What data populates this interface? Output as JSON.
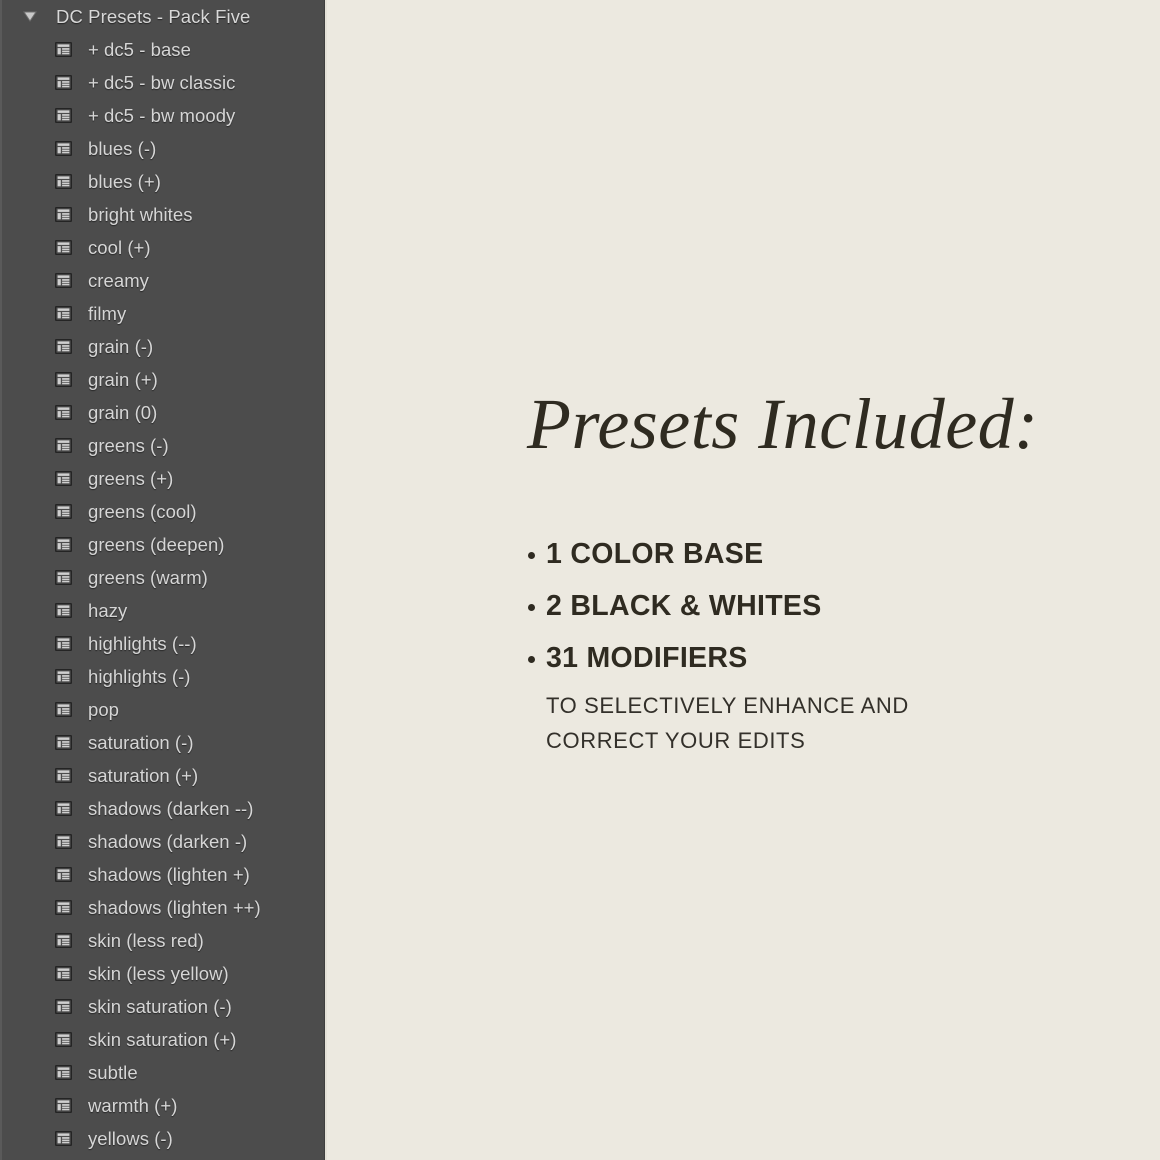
{
  "colors": {
    "sidebar_bg": "#4c4c4c",
    "sidebar_text": "#d6d6d6",
    "panel_bg": "#ece9e0",
    "panel_text": "#2f2b21"
  },
  "sidebar": {
    "group": {
      "title": "DC Presets - Pack Five",
      "disclosure_icon": "triangle-down-icon",
      "expanded": true
    },
    "item_icon": "preset-table-icon",
    "items": [
      {
        "label": "+ dc5 - base"
      },
      {
        "label": "+ dc5 - bw classic"
      },
      {
        "label": "+ dc5 - bw moody"
      },
      {
        "label": "blues (-)"
      },
      {
        "label": "blues (+)"
      },
      {
        "label": "bright whites"
      },
      {
        "label": "cool (+)"
      },
      {
        "label": "creamy"
      },
      {
        "label": "filmy"
      },
      {
        "label": "grain (-)"
      },
      {
        "label": "grain (+)"
      },
      {
        "label": "grain (0)"
      },
      {
        "label": "greens (-)"
      },
      {
        "label": "greens (+)"
      },
      {
        "label": "greens (cool)"
      },
      {
        "label": "greens (deepen)"
      },
      {
        "label": "greens (warm)"
      },
      {
        "label": "hazy"
      },
      {
        "label": "highlights (--)"
      },
      {
        "label": "highlights (-)"
      },
      {
        "label": "pop"
      },
      {
        "label": "saturation (-)"
      },
      {
        "label": "saturation (+)"
      },
      {
        "label": "shadows (darken --)"
      },
      {
        "label": "shadows (darken -)"
      },
      {
        "label": "shadows (lighten +)"
      },
      {
        "label": "shadows (lighten ++)"
      },
      {
        "label": "skin (less red)"
      },
      {
        "label": "skin (less yellow)"
      },
      {
        "label": "skin saturation (-)"
      },
      {
        "label": "skin saturation (+)"
      },
      {
        "label": "subtle"
      },
      {
        "label": "warmth (+)"
      },
      {
        "label": "yellows (-)"
      }
    ]
  },
  "panel": {
    "headline": "Presets Included:",
    "bullets": [
      {
        "text": "1 COLOR BASE"
      },
      {
        "text": "2 BLACK & WHITES"
      },
      {
        "text": "31 MODIFIERS"
      }
    ],
    "subnote_line_1": "TO SELECTIVELY ENHANCE AND",
    "subnote_line_2": "CORRECT YOUR EDITS"
  }
}
